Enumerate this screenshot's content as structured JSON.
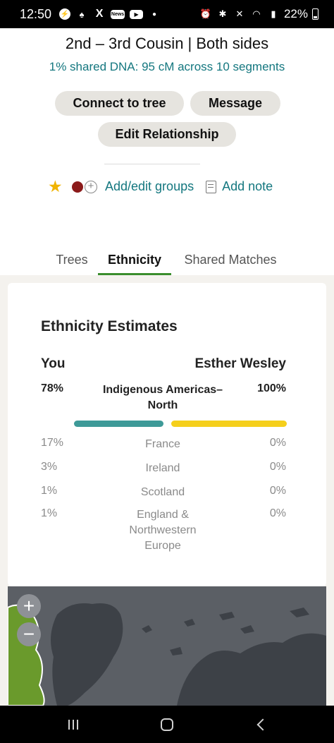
{
  "status_bar": {
    "time": "12:50",
    "battery": "22%",
    "icons": [
      "messenger-icon",
      "notification-icon",
      "x-icon",
      "news-icon",
      "youtube-icon",
      "dot-icon",
      "alarm-icon",
      "bluetooth-icon",
      "mute-icon",
      "wifi-icon",
      "signal-icon",
      "battery-icon"
    ]
  },
  "header": {
    "relationship": "2nd – 3rd Cousin | Both sides",
    "shared_dna": "1% shared DNA: 95 cM across 10 segments"
  },
  "buttons": {
    "connect": "Connect to tree",
    "message": "Message",
    "edit_relationship": "Edit Relationship"
  },
  "actions": {
    "star_icon": "star-icon",
    "group_color": "#8b1a1a",
    "add_groups": "Add/edit groups",
    "add_note": "Add note"
  },
  "tabs": [
    {
      "label": "Trees",
      "active": false
    },
    {
      "label": "Ethnicity",
      "active": true
    },
    {
      "label": "Shared Matches",
      "active": false
    }
  ],
  "ethnicity": {
    "title": "Ethnicity Estimates",
    "you_label": "You",
    "match_label": "Esther Wesley",
    "primary": {
      "you": "78%",
      "region": "Indigenous Americas–North",
      "match": "100%",
      "you_color": "#3e9a98",
      "match_color": "#f5cf1b"
    },
    "rows": [
      {
        "you": "17%",
        "region": "France",
        "match": "0%"
      },
      {
        "you": "3%",
        "region": "Ireland",
        "match": "0%"
      },
      {
        "you": "1%",
        "region": "Scotland",
        "match": "0%"
      },
      {
        "you": "1%",
        "region": "England & Northwestern Europe",
        "match": "0%"
      }
    ]
  },
  "map": {
    "zoom_in": "+",
    "zoom_out": "−"
  }
}
